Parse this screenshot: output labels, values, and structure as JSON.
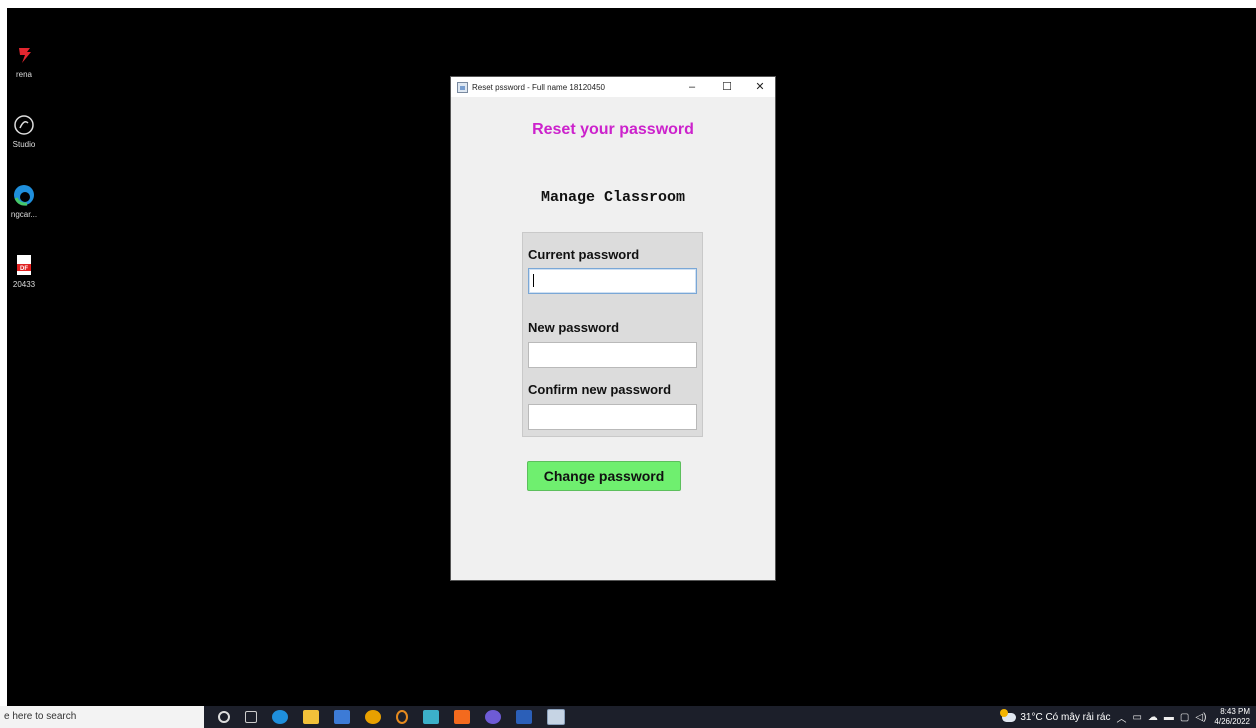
{
  "desktop": {
    "icons": [
      {
        "label": "rena",
        "icon": "garena-icon"
      },
      {
        "label": "Studio",
        "icon": "studio-icon"
      },
      {
        "label": "ngcar...",
        "icon": "edge-icon"
      },
      {
        "label": "20433",
        "icon": "pdf-icon"
      }
    ]
  },
  "window": {
    "title": "Reset pssword - Full name 18120450",
    "controls": {
      "minimize": "–",
      "maximize": "☐",
      "close": "✕"
    },
    "heading": "Reset your password",
    "subheading": "Manage Classroom",
    "fields": {
      "current_label": "Current password",
      "current_value": "",
      "new_label": "New password",
      "new_value": "",
      "confirm_label": "Confirm new password",
      "confirm_value": ""
    },
    "button_label": "Change password",
    "colors": {
      "heading": "#cc22cc",
      "button": "#6fef6f"
    }
  },
  "taskbar": {
    "search_placeholder": "e here to search",
    "weather": "31°C  Có mây rải rác",
    "time": "8:43 PM",
    "date": "4/26/2022"
  }
}
